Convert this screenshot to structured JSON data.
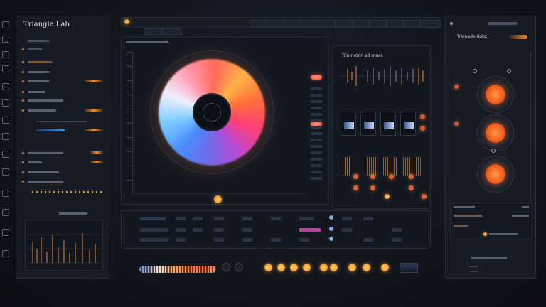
{
  "app": {
    "title": "Triangle Lab"
  },
  "left_panel": {
    "rows": [
      "",
      "",
      "",
      "",
      "",
      "",
      "",
      "",
      "",
      "",
      "",
      "",
      ""
    ]
  },
  "right_panel": {
    "header": "Trianode dubz"
  },
  "center": {
    "spectrum_title": "Trinmoton ad maas"
  },
  "colors": {
    "accent": "#f28a2c",
    "knob": "#f05a1c",
    "bg": "#11151d"
  },
  "icons": [
    "gear-icon",
    "plus-icon",
    "mixer-icon",
    "waveform-icon"
  ]
}
